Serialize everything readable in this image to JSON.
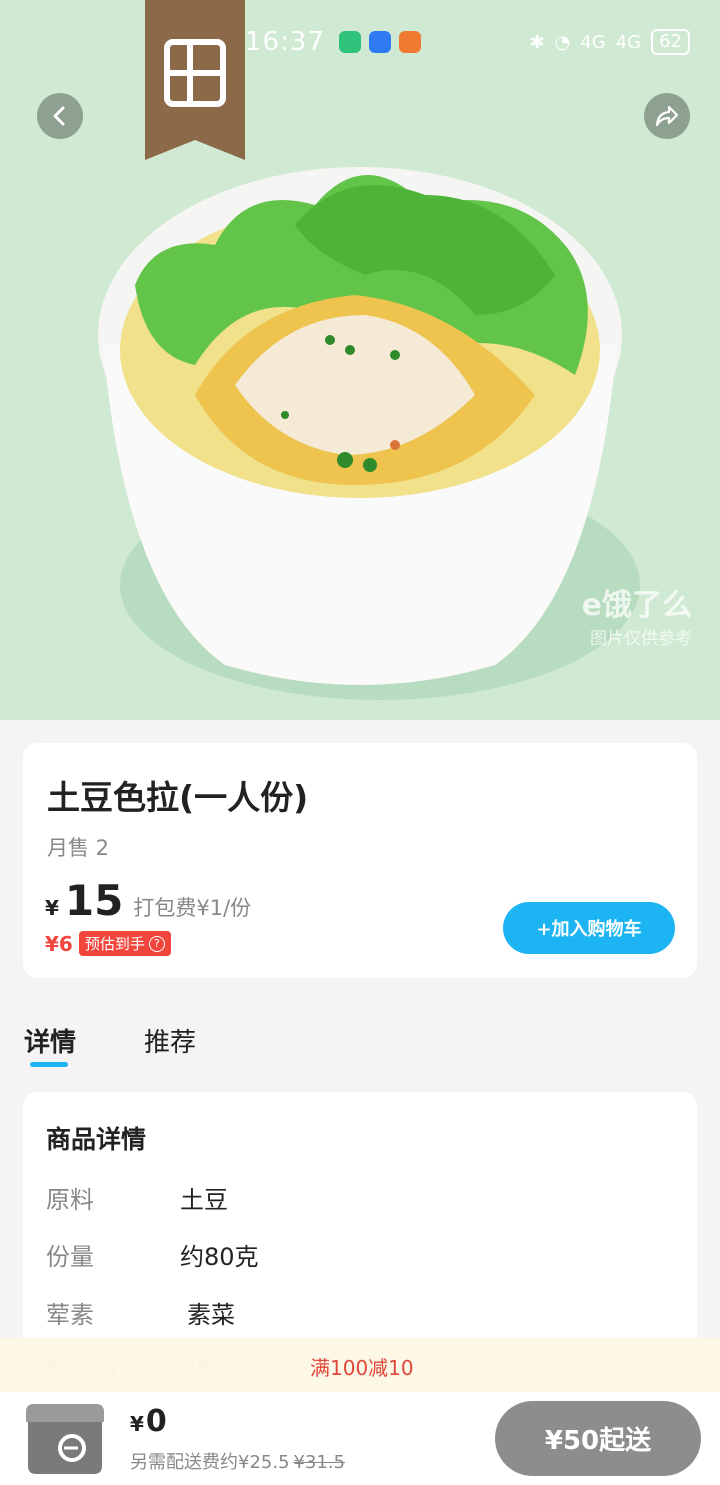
{
  "status_bar": {
    "time": "16:37",
    "network_1": "4G",
    "network_2": "4G",
    "battery": "62"
  },
  "hero": {
    "watermark_line1": "e饿了么",
    "watermark_line2": "图片仅供参考"
  },
  "product": {
    "title": "土豆色拉(一人份)",
    "monthly_sales": "月售 2",
    "currency": "¥",
    "price": "15",
    "packing_fee": "打包费¥1/份",
    "estimated_price": "¥6",
    "estimated_label": "预估到手",
    "add_to_cart": "+加入购物车"
  },
  "tabs": [
    {
      "label": "详情",
      "active": true
    },
    {
      "label": "推荐",
      "active": false
    }
  ],
  "details": {
    "section_title": "商品详情",
    "rows": [
      {
        "key": "原料",
        "value": "土豆"
      },
      {
        "key": "份量",
        "value": "约80克"
      },
      {
        "key": "荤素",
        "value": "素菜"
      },
      {
        "key": "制作方法",
        "value": "拌"
      }
    ]
  },
  "promo": {
    "text": "满100减10"
  },
  "cart": {
    "currency": "¥",
    "total": "0",
    "delivery_note": "另需配送费约¥25.5",
    "delivery_original": "¥31.5",
    "min_order_button": "¥50起送"
  },
  "colors": {
    "accent": "#1cb4f2",
    "discount_red": "#f2463c",
    "hero_bg": "#cfe9d3",
    "disabled_button": "#8d8d8d"
  }
}
